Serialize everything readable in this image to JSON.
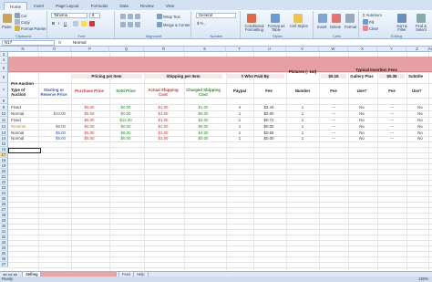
{
  "ribbon": {
    "tabs": [
      "Home",
      "Insert",
      "Page Layout",
      "Formulas",
      "Data",
      "Review",
      "View"
    ],
    "clipboard": {
      "paste": "Paste",
      "cut": "Cut",
      "copy": "Copy",
      "format_painter": "Format Painter",
      "label": "Clipboard"
    },
    "font": {
      "name": "Tahoma",
      "size": "8",
      "label": "Font"
    },
    "alignment": {
      "wrap": "Wrap Text",
      "merge": "Merge & Center",
      "label": "Alignment"
    },
    "number": {
      "format": "General",
      "label": "Number"
    },
    "styles": {
      "conditional": "Conditional Formatting",
      "format_table": "Format as Table",
      "cell_styles": "Cell Styles",
      "label": "Styles"
    },
    "cells": {
      "insert": "Insert",
      "delete": "Delete",
      "format": "Format",
      "label": "Cells"
    },
    "editing": {
      "autosum": "AutoSum",
      "fill": "Fill",
      "clear": "Clear",
      "sort": "Sort & Filter",
      "find": "Find & Select",
      "label": "Editing"
    }
  },
  "formula_bar": {
    "name_box": "N17",
    "fx": "fx",
    "value": "Normal"
  },
  "columns": [
    "N",
    "O",
    "P",
    "Q",
    "R",
    "S",
    "T",
    "U",
    "V",
    "W",
    "X",
    "Y",
    "Z",
    "AA"
  ],
  "rows": [
    "3",
    "4",
    "5",
    "6",
    "7",
    "8",
    "9",
    "10",
    "11",
    "12",
    "13",
    "14",
    "15",
    "16",
    "17",
    "18",
    "19",
    "20",
    "21",
    "22",
    "23",
    "24",
    "25",
    "26",
    "27",
    "28",
    "29",
    "30",
    "31",
    "32",
    "33",
    "34",
    "35",
    "36",
    "37"
  ],
  "selected_row": "17",
  "headers": {
    "pre_auction": "Pre-Auction",
    "type_of_auction": "Type of Auction",
    "starting_or_reserve": "Starting or Reserve Price",
    "pricing_per_item": "Pricing per Item",
    "purchase_price": "Purchase Price",
    "sold_price": "Sold Price",
    "shipping_per_item": "Shipping per Item",
    "actual_shipping": "Actual Shipping Cost",
    "charged_shipping": "Charged Shipping Cost",
    "who_paid_by": "# Who Paid By",
    "paypal": "Paypal",
    "fee": "Fee",
    "pictures": "Pictures (- 1st)",
    "number": "Number",
    "typical_fees": "Typical Insertion Fees",
    "fee_015": "$0.15",
    "gallery_plus": "Gallery Plus",
    "fee_035": "$0.35",
    "subtitle": "Subtitle",
    "use": "Use?"
  },
  "data_rows": [
    {
      "type": "Fixed",
      "start": "",
      "purchase": "$5.00",
      "sold": "$0.00",
      "actual": "$1.00",
      "charged": "$1.00",
      "paypal": "4",
      "fee": "$2.44",
      "num": "1",
      "f1": "---",
      "use1": "No",
      "use2": "No"
    },
    {
      "type": "Normal",
      "start": "$10.00",
      "purchase": "$5.00",
      "sold": "$0.00",
      "actual": "$1.00",
      "charged": "$0.00",
      "paypal": "1",
      "fee": "$0.00",
      "num": "1",
      "f1": "---",
      "use1": "No",
      "use2": "No"
    },
    {
      "type": "Fixed",
      "start": "",
      "purchase": "$5.00",
      "sold": "$12.00",
      "actual": "$1.00",
      "charged": "$2.00",
      "paypal": "1",
      "fee": "$0.72",
      "num": "1",
      "f1": "---",
      "use1": "No",
      "use2": "No"
    },
    {
      "type": "Reserve",
      "start": "$5.00",
      "purchase": "$5.00",
      "sold": "$0.00",
      "actual": "$1.00",
      "charged": "$0.00",
      "paypal": "1",
      "fee": "$0.00",
      "num": "1",
      "f1": "---",
      "use1": "No",
      "use2": "No"
    },
    {
      "type": "Normal",
      "start": "$5.00",
      "purchase": "$5.00",
      "sold": "$8.00",
      "actual": "$1.00",
      "charged": "$4.00",
      "paypal": "1",
      "fee": "$0.65",
      "num": "1",
      "f1": "---",
      "use1": "No",
      "use2": "No"
    },
    {
      "type": "Normal",
      "start": "$5.00",
      "purchase": "$5.00",
      "sold": "$0.00",
      "actual": "$1.00",
      "charged": "$0.00",
      "paypal": "1",
      "fee": "$0.00",
      "num": "1",
      "f1": "---",
      "use1": "No",
      "use2": "No"
    }
  ],
  "sheet_tabs": [
    "Selling",
    "Fees",
    "Help"
  ],
  "status": {
    "ready": "Ready",
    "zoom": "100%"
  }
}
